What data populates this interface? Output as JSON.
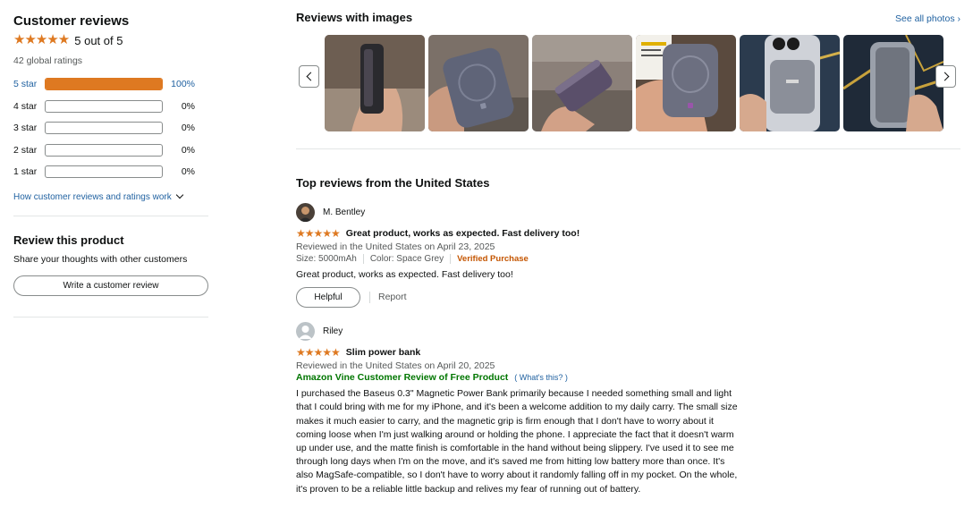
{
  "summary": {
    "title": "Customer reviews",
    "stars": "★★★★★",
    "rating_text": "5 out of 5",
    "global_ratings": "42 global ratings",
    "average_rating": 5,
    "histogram": [
      {
        "label": "5 star",
        "percent_text": "100%",
        "percent": 100
      },
      {
        "label": "4 star",
        "percent_text": "0%",
        "percent": 0
      },
      {
        "label": "3 star",
        "percent_text": "0%",
        "percent": 0
      },
      {
        "label": "2 star",
        "percent_text": "0%",
        "percent": 0
      },
      {
        "label": "1 star",
        "percent_text": "0%",
        "percent": 0
      }
    ],
    "how_link": "How customer reviews and ratings work"
  },
  "review_product": {
    "title": "Review this product",
    "subtitle": "Share your thoughts with other customers",
    "button": "Write a customer review"
  },
  "images_section": {
    "title": "Reviews with images",
    "see_all": "See all photos"
  },
  "top_reviews": {
    "title": "Top reviews from the United States",
    "reviews": [
      {
        "name": "M. Bentley",
        "stars": "★★★★★",
        "rating": 5,
        "title": "Great product, works as expected. Fast delivery too!",
        "meta": "Reviewed in the United States on April 23, 2025",
        "size": "Size: 5000mAh",
        "color": "Color: Space Grey",
        "verified": "Verified Purchase",
        "body": "Great product, works as expected. Fast delivery too!",
        "helpful": "Helpful",
        "report": "Report"
      },
      {
        "name": "Riley",
        "stars": "★★★★★",
        "rating": 5,
        "title": "Slim power bank",
        "meta": "Reviewed in the United States on April 20, 2025",
        "vine": "Amazon Vine Customer Review of Free Product",
        "whats_this": "( What's this? )",
        "body": "I purchased the Baseus 0.3\" Magnetic Power Bank primarily because I needed something small and light that I could bring with me for my iPhone, and it's been a welcome addition to my daily carry. The small size makes it much easier to carry, and the magnetic grip is firm enough that I don't have to worry about it coming loose when I'm just walking around or holding the phone. I appreciate the fact that it doesn't warm up under use, and the matte finish is comfortable in the hand without being slippery. I've used it to see me through long days when I'm on the move, and it's saved me from hitting low battery more than once. It's also MagSafe-compatible, so I don't have to worry about it randomly falling off in my pocket. On the whole, it's proven to be a reliable little backup and relives my fear of running out of battery."
      }
    ]
  },
  "colors": {
    "star": "#de7921",
    "link": "#2162a1",
    "verified": "#c45500",
    "vine": "#007600"
  }
}
